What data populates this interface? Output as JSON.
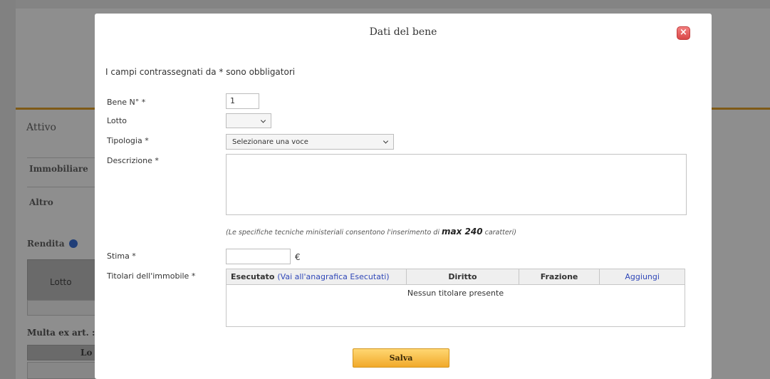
{
  "background": {
    "section_title": "Attivo",
    "tab_immobiliare": "Immobiliare",
    "tab_altro": "Altro",
    "rendita_label": "Rendita",
    "lotto_header": "Lotto",
    "multa_label": "Multa ex art. :",
    "lo_header": "Lo"
  },
  "dialog": {
    "title": "Dati del bene",
    "close_icon": "close-icon",
    "required_note": "I campi contrassegnati da * sono obbligatori",
    "fields": {
      "bene_label": "Bene N° *",
      "bene_value": "1",
      "lotto_label": "Lotto",
      "lotto_value": "",
      "tipologia_label": "Tipologia *",
      "tipologia_value": "Selezionare una voce",
      "descrizione_label": "Descrizione *",
      "descrizione_value": "",
      "hint_text": "(Le specifiche tecniche ministeriali consentono l'inserimento di",
      "hint_max": "max 240",
      "hint_tail": "caratteri)",
      "stima_label": "Stima *",
      "stima_value": "",
      "currency": "€",
      "titolari_label": "Titolari dell'immobile *"
    },
    "owners_table": {
      "col_esecutato": "Esecutato",
      "esecutato_link": "(Vai all'anagrafica Esecutati)",
      "col_diritto": "Diritto",
      "col_frazione": "Frazione",
      "add_link": "Aggiungi",
      "empty_text": "Nessun titolare presente"
    },
    "save_label": "Salva"
  },
  "colors": {
    "accent": "#f1a92a",
    "link": "#3048b8",
    "close": "#d94848"
  }
}
